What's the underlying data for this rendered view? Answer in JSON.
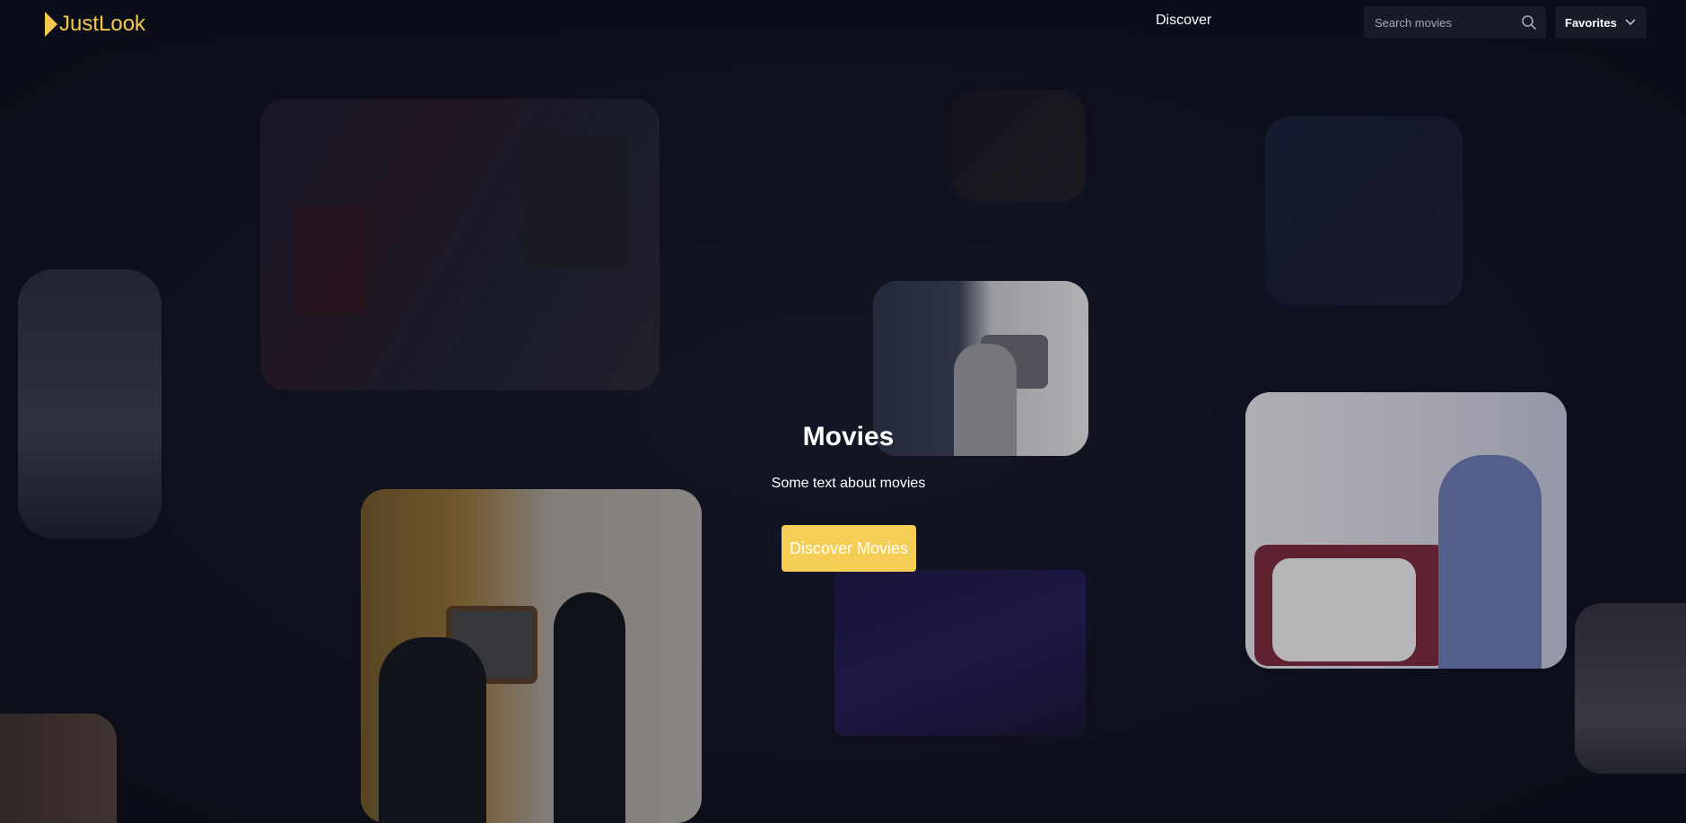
{
  "brand": {
    "name": "JustLook",
    "accent": "#f5c84c"
  },
  "nav": {
    "discover_label": "Discover"
  },
  "search": {
    "placeholder": "Search movies",
    "value": ""
  },
  "favorites": {
    "label": "Favorites"
  },
  "hero": {
    "title": "Movies",
    "subtitle": "Some text about movies",
    "cta_label": "Discover Movies",
    "cta_color": "#f5cf55"
  },
  "icons": {
    "search": "search-icon",
    "favorites_dropdown": "chevron-down-icon",
    "logo": "play-triangle-icon"
  }
}
